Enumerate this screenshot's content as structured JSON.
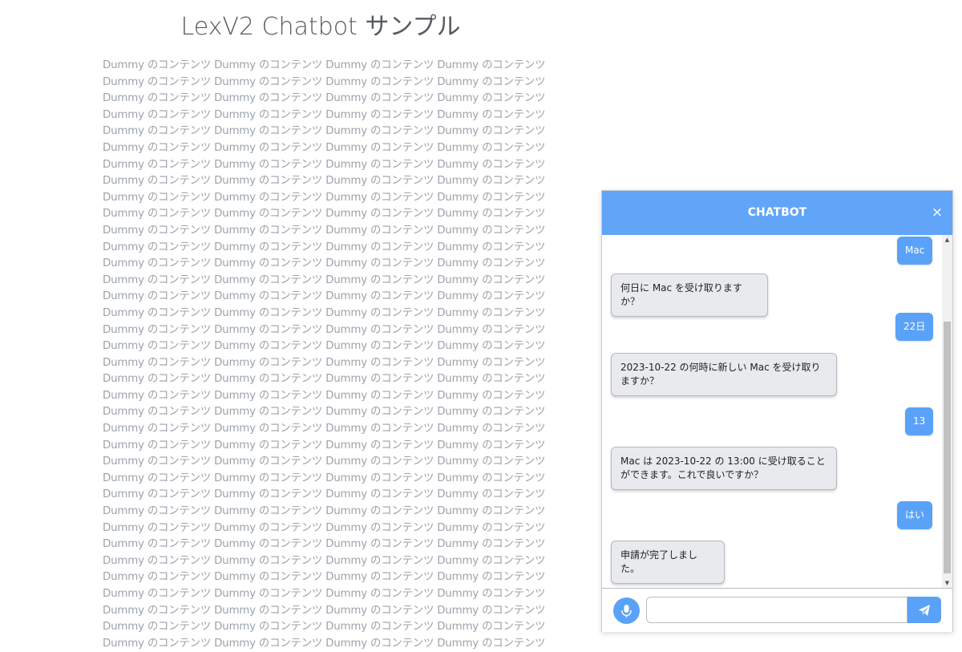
{
  "page": {
    "title": "LexV2 Chatbot サンプル",
    "dummy_line": "Dummy のコンテンツ Dummy のコンテンツ Dummy のコンテンツ Dummy のコンテンツ"
  },
  "chatbot": {
    "title": "CHATBOT",
    "close_label": "×",
    "messages": [
      {
        "from": "user",
        "text": "Mac"
      },
      {
        "from": "bot",
        "text": "何日に Mac を受け取りますか？"
      },
      {
        "from": "user",
        "text": "22日"
      },
      {
        "from": "bot",
        "text": "2023-10-22 の何時に新しい Mac を受け取りますか？"
      },
      {
        "from": "user",
        "text": "13"
      },
      {
        "from": "bot",
        "text": "Mac は 2023-10-22 の 13:00 に受け取ることができます。これで良いですか？"
      },
      {
        "from": "user",
        "text": "はい"
      },
      {
        "from": "bot",
        "text": "申請が完了しました。"
      }
    ],
    "input": {
      "value": "",
      "placeholder": ""
    },
    "mic_icon": "microphone-icon",
    "send_icon": "paper-plane-icon"
  },
  "colors": {
    "accent": "#60a5f8",
    "user_bubble": "#5aa2f7",
    "bot_bubble": "#e9eaed",
    "dummy_text": "#9ba3ab"
  }
}
